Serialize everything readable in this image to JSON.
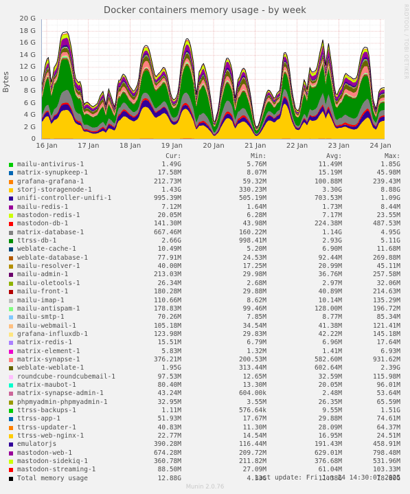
{
  "graph": {
    "title": "Docker containers memory usage - by week",
    "watermark": "RRDTOOL / TOBI OETIKER",
    "ylabel": "Bytes",
    "version_footer": "Munin 2.0.76",
    "last_update": "Last update: Fri Jan 24 14:30:07 2025"
  },
  "legend": {
    "headers": {
      "cur": "Cur:",
      "min": "Min:",
      "avg": "Avg:",
      "max": "Max:"
    }
  },
  "chart_data": {
    "type": "area",
    "title": "Docker containers memory usage - by week",
    "xlabel": "",
    "ylabel": "Bytes",
    "ylim": [
      0,
      20000000000
    ],
    "ytick_labels": [
      "0",
      "2 G",
      "4 G",
      "6 G",
      "8 G",
      "10 G",
      "12 G",
      "14 G",
      "16 G",
      "18 G",
      "20 G"
    ],
    "ytick_values": [
      0,
      2,
      4,
      6,
      8,
      10,
      12,
      14,
      16,
      18,
      20
    ],
    "xtick_labels": [
      "16 Jan",
      "17 Jan",
      "18 Jan",
      "19 Jan",
      "20 Jan",
      "21 Jan",
      "22 Jan",
      "23 Jan",
      "24 Jan"
    ],
    "grid": true,
    "legend_position": "below",
    "stacked": true,
    "series": [
      {
        "name": "mailu-antivirus-1",
        "color": "#00cc00",
        "cur": "1.49G",
        "min": "5.76M",
        "avg": "11.49M",
        "max": "1.85G"
      },
      {
        "name": "matrix-synupkeep-1",
        "color": "#0066b3",
        "cur": "17.58M",
        "min": "8.07M",
        "avg": "15.19M",
        "max": "45.98M"
      },
      {
        "name": "grafana-grafana-1",
        "color": "#ff8000",
        "cur": "212.73M",
        "min": "59.32M",
        "avg": "100.88M",
        "max": "239.43M"
      },
      {
        "name": "storj-storagenode-1",
        "color": "#ffcc00",
        "cur": "1.43G",
        "min": "330.23M",
        "avg": "3.30G",
        "max": "8.88G"
      },
      {
        "name": "unifi-controller-unifi-1",
        "color": "#330099",
        "cur": "995.39M",
        "min": "505.19M",
        "avg": "703.53M",
        "max": "1.09G"
      },
      {
        "name": "mailu-redis-1",
        "color": "#990099",
        "cur": "7.12M",
        "min": "1.64M",
        "avg": "1.73M",
        "max": "8.44M"
      },
      {
        "name": "mastodon-redis-1",
        "color": "#ccff00",
        "cur": "20.05M",
        "min": "6.28M",
        "avg": "7.17M",
        "max": "23.55M"
      },
      {
        "name": "mastodon-db-1",
        "color": "#ff0000",
        "cur": "141.30M",
        "min": "43.98M",
        "avg": "224.38M",
        "max": "487.53M"
      },
      {
        "name": "matrix-database-1",
        "color": "#808080",
        "cur": "667.46M",
        "min": "160.22M",
        "avg": "1.14G",
        "max": "4.95G"
      },
      {
        "name": "ttrss-db-1",
        "color": "#008f00",
        "cur": "2.66G",
        "min": "998.41M",
        "avg": "2.93G",
        "max": "5.11G"
      },
      {
        "name": "weblate-cache-1",
        "color": "#00487d",
        "cur": "10.49M",
        "min": "5.20M",
        "avg": "6.90M",
        "max": "11.68M"
      },
      {
        "name": "weblate-database-1",
        "color": "#b35a00",
        "cur": "77.91M",
        "min": "24.53M",
        "avg": "92.44M",
        "max": "269.88M"
      },
      {
        "name": "mailu-resolver-1",
        "color": "#b38f00",
        "cur": "40.00M",
        "min": "17.25M",
        "avg": "20.99M",
        "max": "45.11M"
      },
      {
        "name": "mailu-admin-1",
        "color": "#6b006b",
        "cur": "213.03M",
        "min": "29.98M",
        "avg": "36.76M",
        "max": "257.58M"
      },
      {
        "name": "mailu-oletools-1",
        "color": "#8fb300",
        "cur": "26.34M",
        "min": "2.68M",
        "avg": "2.97M",
        "max": "32.06M"
      },
      {
        "name": "mailu-front-1",
        "color": "#b30000",
        "cur": "180.28M",
        "min": "29.88M",
        "avg": "40.89M",
        "max": "214.63M"
      },
      {
        "name": "mailu-imap-1",
        "color": "#bebebe",
        "cur": "110.66M",
        "min": "8.62M",
        "avg": "10.14M",
        "max": "135.29M"
      },
      {
        "name": "mailu-antispam-1",
        "color": "#80ff80",
        "cur": "178.83M",
        "min": "99.46M",
        "avg": "128.00M",
        "max": "196.72M"
      },
      {
        "name": "mailu-smtp-1",
        "color": "#80c9ff",
        "cur": "70.26M",
        "min": "7.85M",
        "avg": "8.77M",
        "max": "85.34M"
      },
      {
        "name": "mailu-webmail-1",
        "color": "#ffc080",
        "cur": "105.18M",
        "min": "34.54M",
        "avg": "41.38M",
        "max": "121.41M"
      },
      {
        "name": "grafana-influxdb-1",
        "color": "#ffe680",
        "cur": "123.98M",
        "min": "29.83M",
        "avg": "42.22M",
        "max": "145.18M"
      },
      {
        "name": "matrix-redis-1",
        "color": "#aa80ff",
        "cur": "15.51M",
        "min": "6.79M",
        "avg": "6.96M",
        "max": "17.64M"
      },
      {
        "name": "matrix-element-1",
        "color": "#ee00cc",
        "cur": "5.83M",
        "min": "1.32M",
        "avg": "1.41M",
        "max": "6.93M"
      },
      {
        "name": "matrix-synapse-1",
        "color": "#ff8080",
        "cur": "376.21M",
        "min": "200.53M",
        "avg": "582.60M",
        "max": "931.62M"
      },
      {
        "name": "weblate-weblate-1",
        "color": "#666600",
        "cur": "1.95G",
        "min": "313.44M",
        "avg": "602.64M",
        "max": "2.39G"
      },
      {
        "name": "roundcube-roundcubemail-1",
        "color": "#ffbfff",
        "cur": "97.53M",
        "min": "12.65M",
        "avg": "32.59M",
        "max": "115.98M"
      },
      {
        "name": "matrix-maubot-1",
        "color": "#00ffcc",
        "cur": "80.40M",
        "min": "13.30M",
        "avg": "20.05M",
        "max": "96.01M"
      },
      {
        "name": "matrix-synapse-admin-1",
        "color": "#cc6699",
        "cur": "43.24M",
        "min": "604.00k",
        "avg": "2.48M",
        "max": "53.64M"
      },
      {
        "name": "phpmyadmin-phpmyadmin-1",
        "color": "#999900",
        "cur": "32.95M",
        "min": "3.55M",
        "avg": "26.35M",
        "max": "65.59M"
      },
      {
        "name": "ttrss-backups-1",
        "color": "#00cc00",
        "cur": "1.11M",
        "min": "576.64k",
        "avg": "9.55M",
        "max": "1.51G"
      },
      {
        "name": "ttrss-app-1",
        "color": "#0066b3",
        "cur": "51.93M",
        "min": "17.67M",
        "avg": "29.88M",
        "max": "74.61M"
      },
      {
        "name": "ttrss-updater-1",
        "color": "#ff8000",
        "cur": "40.83M",
        "min": "11.30M",
        "avg": "28.09M",
        "max": "64.37M"
      },
      {
        "name": "ttrss-web-nginx-1",
        "color": "#ffcc00",
        "cur": "22.77M",
        "min": "14.54M",
        "avg": "16.95M",
        "max": "24.51M"
      },
      {
        "name": "emulatorjs",
        "color": "#330099",
        "cur": "390.28M",
        "min": "116.44M",
        "avg": "191.43M",
        "max": "458.91M"
      },
      {
        "name": "mastodon-web-1",
        "color": "#990099",
        "cur": "674.28M",
        "min": "209.72M",
        "avg": "629.01M",
        "max": "798.48M"
      },
      {
        "name": "mastodon-sidekiq-1",
        "color": "#ccff00",
        "cur": "360.78M",
        "min": "211.82M",
        "avg": "376.68M",
        "max": "531.96M"
      },
      {
        "name": "mastodon-streaming-1",
        "color": "#ff0000",
        "cur": "88.50M",
        "min": "27.09M",
        "avg": "61.04M",
        "max": "103.33M"
      },
      {
        "name": "Total memory usage",
        "color": "#000000",
        "cur": "12.88G",
        "min": "4.33G",
        "avg": "11.38G",
        "max": "18.80G"
      }
    ]
  }
}
